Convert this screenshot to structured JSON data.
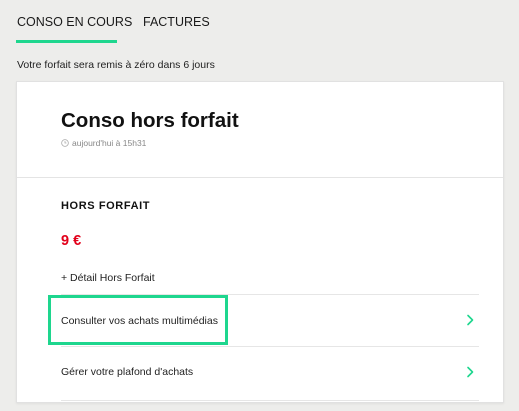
{
  "tabs": [
    {
      "label": "CONSO EN COURS",
      "active": true
    },
    {
      "label": "FACTURES",
      "active": false
    }
  ],
  "notice": "Votre forfait sera remis à zéro dans 6 jours",
  "card": {
    "title": "Conso hors forfait",
    "timestamp": "aujourd'hui à 15h31",
    "section_label": "HORS FORFAIT",
    "amount": "9 €",
    "detail_link": "+ Détail Hors Forfait",
    "rows": [
      {
        "label": "Consulter vos achats multimédias",
        "icon": "chevron-right-icon",
        "highlighted": true
      },
      {
        "label": "Gérer votre plafond d'achats",
        "icon": "chevron-right-icon",
        "highlighted": false
      }
    ]
  },
  "colors": {
    "accent": "#1ed68e",
    "amount": "#e2001a",
    "background": "#ededeb"
  }
}
